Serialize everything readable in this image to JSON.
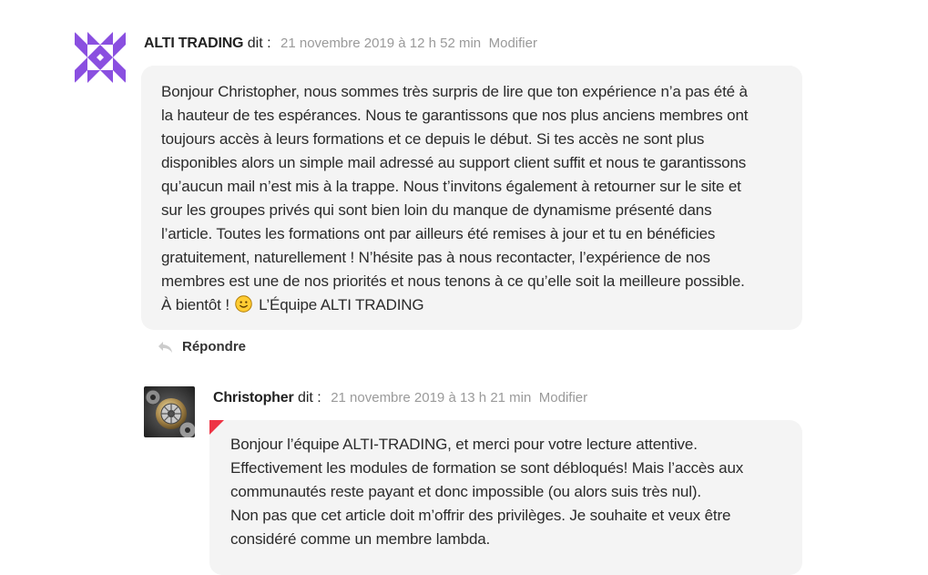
{
  "comments": [
    {
      "author": "ALTI TRADING",
      "says": "dit :",
      "date": "21 novembre 2019 à 12 h 52 min",
      "edit_label": "Modifier",
      "body_lines": [
        "Bonjour Christopher, nous sommes très surpris de lire que ton expérience n’a pas été à",
        "la hauteur de tes espérances. Nous te garantissons que nos plus anciens membres ont",
        "toujours accès à leurs formations et ce depuis le début. Si tes accès ne sont plus",
        "disponibles alors un simple mail adressé au support client suffit et nous te garantissons",
        "qu’aucun mail n’est mis à la trappe. Nous t’invitons également à retourner sur le site et",
        "sur les groupes privés qui sont bien loin du manque de dynamisme présenté dans",
        "l’article. Toutes les formations ont par ailleurs été remises à jour et tu en bénéficies",
        "gratuitement, naturellement ! N’hésite pas à nous recontacter, l’expérience de nos",
        "membres est une de nos priorités et nous tenons à ce qu’elle soit la meilleure possible."
      ],
      "last_line_before": "À bientôt !",
      "last_line_after": "L’Équipe ALTI TRADING",
      "reply_label": "Répondre"
    },
    {
      "author": "Christopher",
      "says": "dit :",
      "date": "21 novembre 2019 à 13 h 21 min",
      "edit_label": "Modifier",
      "body_lines": [
        "Bonjour l’équipe ALTI-TRADING, et merci pour votre lecture attentive.",
        "Effectivement les modules de formation se sont débloqués! Mais l’accès aux",
        "communautés reste payant et donc impossible (ou alors suis très nul).",
        "Non pas que cet article doit m’offrir des privilèges. Je souhaite et veux être",
        "considéré comme un membre lambda."
      ]
    }
  ],
  "colors": {
    "bubble_bg": "#f4f4f4",
    "date_gray": "#9a9a9a",
    "avatar_purple": "#8a4fe0",
    "flag_red": "#ee3344"
  }
}
